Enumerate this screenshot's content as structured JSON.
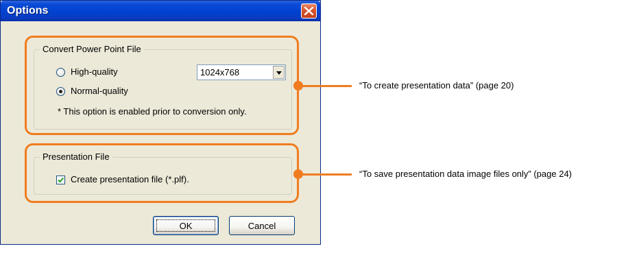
{
  "dialog": {
    "title": "Options",
    "close_icon": "close-icon",
    "convert_group": {
      "legend": "Convert Power Point File",
      "high_quality_label": "High-quality",
      "normal_quality_label": "Normal-quality",
      "selected_option": "Normal-quality",
      "resolution_value": "1024x768",
      "note": "* This option is enabled prior to conversion only."
    },
    "presentation_group": {
      "legend": "Presentation File",
      "checkbox_label": "Create presentation file (*.plf).",
      "checkbox_checked": true
    },
    "ok_label": "OK",
    "cancel_label": "Cancel"
  },
  "annotations": {
    "convert_note": "“To create presentation data” (page 20)",
    "presentation_note": "“To save presentation data image files only” (page 24)",
    "color": "#f07c1f"
  },
  "theme": {
    "titlebar_color": "#0042d0",
    "dialog_bg": "#ece9d8"
  }
}
